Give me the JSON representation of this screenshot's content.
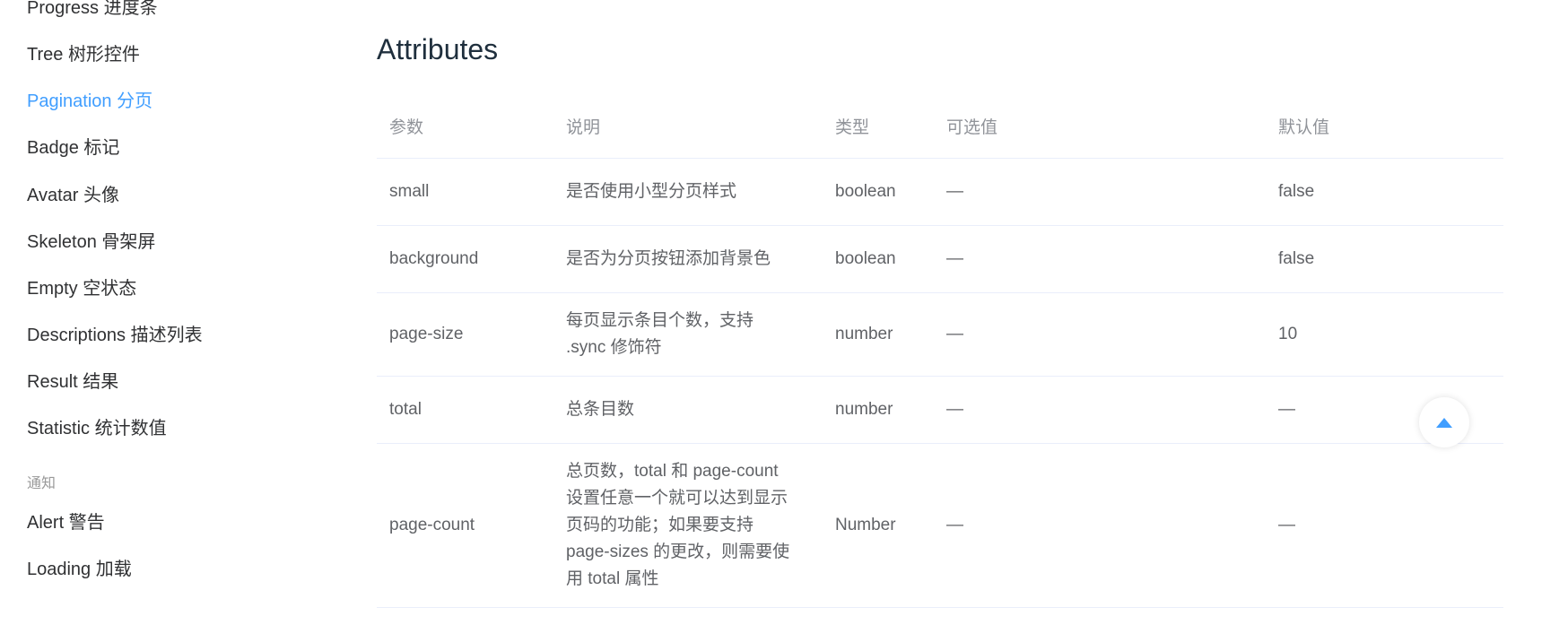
{
  "sidebar": {
    "items": [
      {
        "label": "Progress 进度条"
      },
      {
        "label": "Tree 树形控件"
      },
      {
        "label": "Pagination 分页"
      },
      {
        "label": "Badge 标记"
      },
      {
        "label": "Avatar 头像"
      },
      {
        "label": "Skeleton 骨架屏"
      },
      {
        "label": "Empty 空状态"
      },
      {
        "label": "Descriptions 描述列表"
      },
      {
        "label": "Result 结果"
      },
      {
        "label": "Statistic 统计数值"
      }
    ],
    "active_index": 2,
    "group_label": "通知",
    "group_items": [
      {
        "label": "Alert 警告"
      },
      {
        "label": "Loading 加载"
      }
    ]
  },
  "main": {
    "title": "Attributes",
    "table": {
      "headers": [
        "参数",
        "说明",
        "类型",
        "可选值",
        "默认值"
      ],
      "rows": [
        {
          "param": "small",
          "desc": "是否使用小型分页样式",
          "type": "boolean",
          "options": "—",
          "default": "false"
        },
        {
          "param": "background",
          "desc": "是否为分页按钮添加背景色",
          "type": "boolean",
          "options": "—",
          "default": "false"
        },
        {
          "param": "page-size",
          "desc": "每页显示条目个数，支持 .sync 修饰符",
          "type": "number",
          "options": "—",
          "default": "10"
        },
        {
          "param": "total",
          "desc": "总条目数",
          "type": "number",
          "options": "—",
          "default": "—"
        },
        {
          "param": "page-count",
          "desc": "总页数，total 和 page-count 设置任意一个就可以达到显示页码的功能；如果要支持 page-sizes 的更改，则需要使用 total 属性",
          "type": "Number",
          "options": "—",
          "default": "—"
        }
      ]
    }
  },
  "colors": {
    "accent": "#409EFF",
    "text": "#606266",
    "muted": "#909399",
    "border": "#eaeefb"
  },
  "back_to_top": {
    "icon": "caret-up-icon"
  }
}
